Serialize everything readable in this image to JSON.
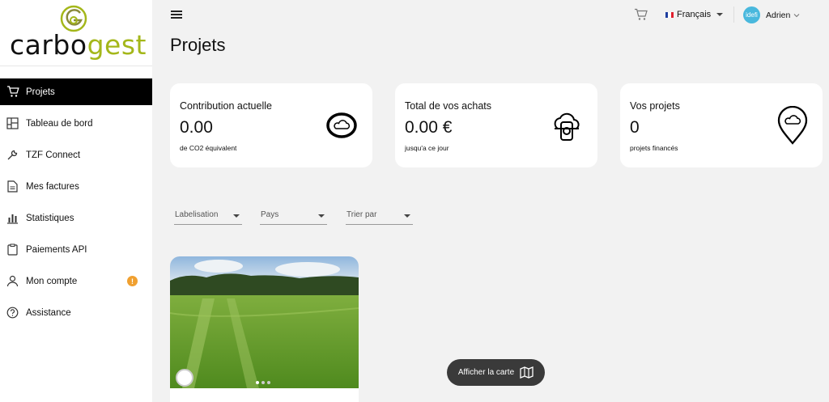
{
  "brand": {
    "logo_part1": "carbo",
    "logo_part2": "gest",
    "accent": "#a4b71a"
  },
  "sidebar": {
    "items": [
      {
        "label": "Projets",
        "icon": "cart-icon",
        "active": true
      },
      {
        "label": "Tableau de bord",
        "icon": "dashboard-icon"
      },
      {
        "label": "TZF Connect",
        "icon": "wrench-icon"
      },
      {
        "label": "Mes factures",
        "icon": "document-icon"
      },
      {
        "label": "Statistiques",
        "icon": "bar-chart-icon"
      },
      {
        "label": "Paiements API",
        "icon": "clipboard-icon"
      },
      {
        "label": "Mon compte",
        "icon": "user-icon",
        "badge": "!"
      },
      {
        "label": "Assistance",
        "icon": "help-icon"
      }
    ]
  },
  "topbar": {
    "language": "Français",
    "avatar_text": "idefi",
    "user_name": "Adrien"
  },
  "page": {
    "title": "Projets"
  },
  "stats": [
    {
      "title": "Contribution actuelle",
      "value": "0.00",
      "sub": "de CO2 équivalent",
      "icon": "cloud-icon"
    },
    {
      "title": "Total de vos achats",
      "value": "0.00 €",
      "sub": "jusqu'a ce jour",
      "icon": "cloud-coin-icon"
    },
    {
      "title": "Vos projets",
      "value": "0",
      "sub": "projets financés",
      "icon": "cloud-pin-icon"
    }
  ],
  "filters": [
    {
      "placeholder": "Labelisation"
    },
    {
      "placeholder": "Pays"
    },
    {
      "placeholder": "Trier par"
    }
  ],
  "project_card": {
    "image": "grass-field-photo",
    "slide_count": 3,
    "active_slide": 1
  },
  "map_button": {
    "label": "Afficher la carte",
    "icon": "map-icon"
  }
}
